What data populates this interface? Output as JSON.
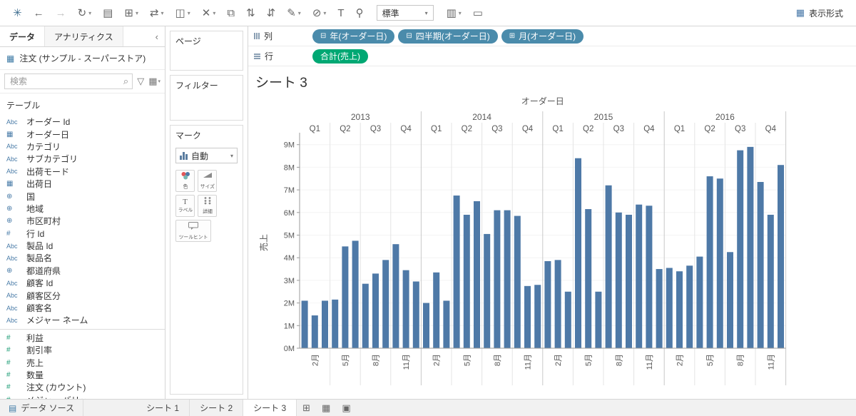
{
  "toolbar": {
    "buttons_left": [
      {
        "name": "tableau-logo-button",
        "glyph": "✳",
        "accent": true
      },
      {
        "name": "undo-button",
        "glyph": "←"
      },
      {
        "name": "redo-button",
        "glyph": "→",
        "disabled": true
      },
      {
        "name": "replay-button",
        "glyph": "↻",
        "caret": true
      },
      {
        "name": "save-button",
        "glyph": "▤"
      },
      {
        "name": "new-worksheet-button",
        "glyph": "⊞",
        "caret": true
      },
      {
        "name": "swap-axes-button",
        "glyph": "⇄",
        "caret": true
      },
      {
        "name": "duplicate-button",
        "glyph": "◫",
        "caret": true
      },
      {
        "name": "clear-sheet-button",
        "glyph": "✕",
        "caret": true
      },
      {
        "name": "group-members-button",
        "glyph": "⧉"
      },
      {
        "name": "sort-ascending-button",
        "glyph": "⇅"
      },
      {
        "name": "sort-descending-button",
        "glyph": "⇵"
      },
      {
        "name": "highlight-button",
        "glyph": "✎",
        "caret": true
      },
      {
        "name": "format-button",
        "glyph": "⊘",
        "caret": true
      },
      {
        "name": "text-label-button",
        "glyph": "T"
      },
      {
        "name": "pin-button",
        "glyph": "⚲"
      }
    ],
    "fit_value": "標準",
    "buttons_right": [
      {
        "name": "show-mark-labels-button",
        "glyph": "▥",
        "caret": true
      },
      {
        "name": "presentation-mode-button",
        "glyph": "▭"
      }
    ],
    "show_me_label": "表示形式"
  },
  "sidebar": {
    "tabs": [
      {
        "label": "データ",
        "active": true
      },
      {
        "label": "アナリティクス",
        "active": false
      }
    ],
    "collapse_glyph": "‹",
    "datasource": "注文 (サンプル - スーパーストア)",
    "search_placeholder": "検索",
    "section_label": "テーブル",
    "fields": [
      {
        "type": "abc",
        "label": "オーダー Id"
      },
      {
        "type": "date",
        "label": "オーダー日"
      },
      {
        "type": "abc",
        "label": "カテゴリ"
      },
      {
        "type": "abc",
        "label": "サブカテゴリ"
      },
      {
        "type": "abc",
        "label": "出荷モード"
      },
      {
        "type": "date",
        "label": "出荷日"
      },
      {
        "type": "globe",
        "label": "国"
      },
      {
        "type": "globe",
        "label": "地域"
      },
      {
        "type": "globe",
        "label": "市区町村"
      },
      {
        "type": "num",
        "label": "行 Id"
      },
      {
        "type": "abc",
        "label": "製品 Id"
      },
      {
        "type": "abc",
        "label": "製品名"
      },
      {
        "type": "globe",
        "label": "都道府県"
      },
      {
        "type": "abc",
        "label": "顧客 Id"
      },
      {
        "type": "abc",
        "label": "顧客区分"
      },
      {
        "type": "abc",
        "label": "顧客名"
      },
      {
        "type": "abc",
        "label": "メジャー ネーム",
        "divider_after": true
      },
      {
        "type": "num",
        "label": "利益",
        "measure": true
      },
      {
        "type": "num",
        "label": "割引率",
        "measure": true
      },
      {
        "type": "num",
        "label": "売上",
        "measure": true
      },
      {
        "type": "num",
        "label": "数量",
        "measure": true
      },
      {
        "type": "num",
        "label": "注文 (カウント)",
        "measure": true
      },
      {
        "type": "num",
        "label": "メジャー バリュー",
        "measure": true
      }
    ]
  },
  "cards": {
    "pages_label": "ページ",
    "filters_label": "フィルター",
    "marks": {
      "label": "マーク",
      "type_value": "自動",
      "buttons": [
        {
          "label": "色"
        },
        {
          "label": "サイズ"
        },
        {
          "label": "ラベル"
        },
        {
          "label": "詳細"
        },
        {
          "label": "ツールヒント"
        }
      ]
    }
  },
  "shelves": {
    "columns_label": "列",
    "rows_label": "行",
    "columns_pills": [
      {
        "label": "年(オーダー日)",
        "state": "minus"
      },
      {
        "label": "四半期(オーダー日)",
        "state": "minus"
      },
      {
        "label": "月(オーダー日)",
        "state": "plus"
      }
    ],
    "rows_pills": [
      {
        "label": "合計(売上)"
      }
    ]
  },
  "sheet": {
    "title": "シート 3"
  },
  "colors": {
    "pill_dimension_blue": "#4a8bab",
    "pill_measure_green": "#00a873",
    "bar_blue": "#4e79a7"
  },
  "chart_data": {
    "type": "bar",
    "title": "オーダー日",
    "ylabel": "売上",
    "ylim_millions": [
      0,
      9
    ],
    "ytick_labels": [
      "0M",
      "1M",
      "2M",
      "3M",
      "4M",
      "5M",
      "6M",
      "7M",
      "8M",
      "9M"
    ],
    "years": [
      "2013",
      "2014",
      "2015",
      "2016"
    ],
    "quarter_labels": [
      "Q1",
      "Q2",
      "Q3",
      "Q4"
    ],
    "month_axis_labels": [
      "2月",
      "5月",
      "8月",
      "11月"
    ],
    "month_axis_positions": [
      1,
      4,
      7,
      10
    ],
    "series_name": "合計(売上)",
    "bar_color": "#4e79a7",
    "grid": "subtle-horizontal",
    "legend": "none",
    "values_millions": {
      "2013": [
        2.1,
        1.45,
        2.1,
        2.15,
        4.5,
        4.75,
        2.85,
        3.3,
        3.9,
        4.6,
        3.45,
        2.95
      ],
      "2014": [
        2.0,
        3.35,
        2.1,
        6.75,
        5.9,
        6.5,
        5.05,
        6.1,
        6.1,
        5.85,
        2.75,
        2.8
      ],
      "2015": [
        3.85,
        3.9,
        2.5,
        8.4,
        6.15,
        2.5,
        7.2,
        6.0,
        5.9,
        6.35,
        6.3,
        3.5
      ],
      "2016": [
        3.55,
        3.4,
        3.65,
        4.05,
        7.6,
        7.5,
        4.25,
        8.75,
        8.9,
        7.35,
        5.9,
        8.1
      ]
    }
  },
  "bottom": {
    "datasource_tab_label": "データ ソース",
    "sheet_tabs": [
      {
        "label": "シート 1",
        "active": false
      },
      {
        "label": "シート 2",
        "active": false
      },
      {
        "label": "シート 3",
        "active": true
      }
    ],
    "new_buttons": [
      {
        "name": "new-worksheet-button",
        "glyph": "⊞"
      },
      {
        "name": "new-dashboard-button",
        "glyph": "▦"
      },
      {
        "name": "new-story-button",
        "glyph": "▣"
      }
    ]
  }
}
